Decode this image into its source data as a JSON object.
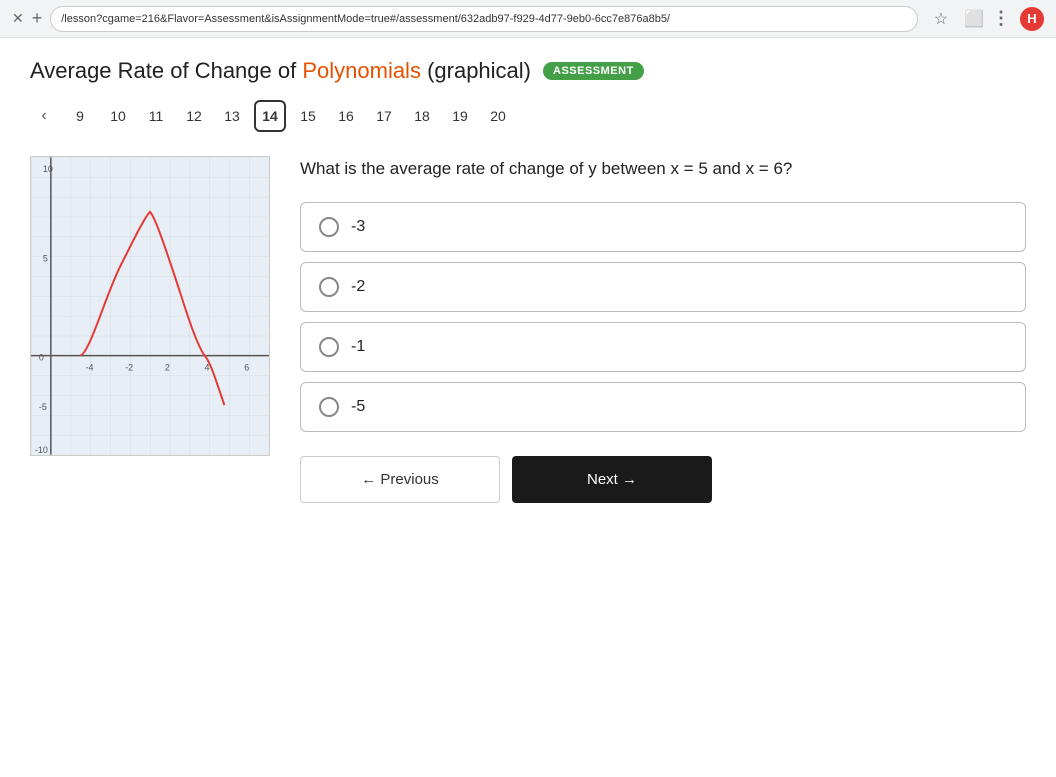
{
  "browser": {
    "url": "/lesson?cgame=216&Flavor=Assessment&isAssignmentMode=true#/assessment/632adb97-f929-4d77-9eb0-6cc7e876a8b5/",
    "avatar_label": "H"
  },
  "header": {
    "title_prefix": "Average Rate of Change of ",
    "title_highlight": "Polynomials",
    "title_suffix": " (graphical)",
    "badge": "ASSESSMENT"
  },
  "pagination": {
    "arrow_left": "‹",
    "pages": [
      {
        "num": "9",
        "active": false
      },
      {
        "num": "10",
        "active": false
      },
      {
        "num": "11",
        "active": false
      },
      {
        "num": "12",
        "active": false
      },
      {
        "num": "13",
        "active": false
      },
      {
        "num": "14",
        "active": true
      },
      {
        "num": "15",
        "active": false
      },
      {
        "num": "16",
        "active": false
      },
      {
        "num": "17",
        "active": false
      },
      {
        "num": "18",
        "active": false
      },
      {
        "num": "19",
        "active": false
      },
      {
        "num": "20",
        "active": false
      }
    ]
  },
  "question": {
    "text": "What is the average rate of change of y between x = 5 and x = 6?"
  },
  "answers": [
    {
      "value": "-3",
      "label": "-3"
    },
    {
      "value": "-2",
      "label": "-2"
    },
    {
      "value": "-1",
      "label": "-1"
    },
    {
      "value": "-5",
      "label": "-5"
    }
  ],
  "buttons": {
    "previous": "← Previous",
    "next": "Next →"
  }
}
